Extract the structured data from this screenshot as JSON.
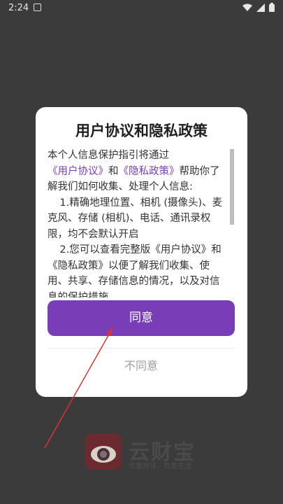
{
  "status_bar": {
    "time": "2:24",
    "icons": [
      "notification-icon",
      "wifi-icon",
      "signal-icon",
      "battery-icon"
    ]
  },
  "brand": {
    "name": "云财宝",
    "slogan": "优惠阅读，改变生活"
  },
  "dialog": {
    "title": "用户协议和隐私政策",
    "content": {
      "intro_prefix": "本个人信息保护指引将通过",
      "link_user_agreement": "《用户协议》",
      "and": "和",
      "link_privacy_policy": "《隐私政策》",
      "intro_suffix": "帮助你了解我们如何收集、处理个人信息:",
      "item_1": "1.精确地理位置、相机 (摄像头)、麦克风、存储 (相机)、电话、通讯录权限，均不会默认开启",
      "item_2": "2.您可以查看完整版《用户协议》和《隐私政策》以便了解我们收集、使用、共享、存储信息的情况，以及对信息的保护措施"
    },
    "agree_label": "同意",
    "disagree_label": "不同意"
  },
  "colors": {
    "accent": "#7a3db8",
    "overlay": "#3b3b3b",
    "annotation_arrow": "#e0312e"
  }
}
